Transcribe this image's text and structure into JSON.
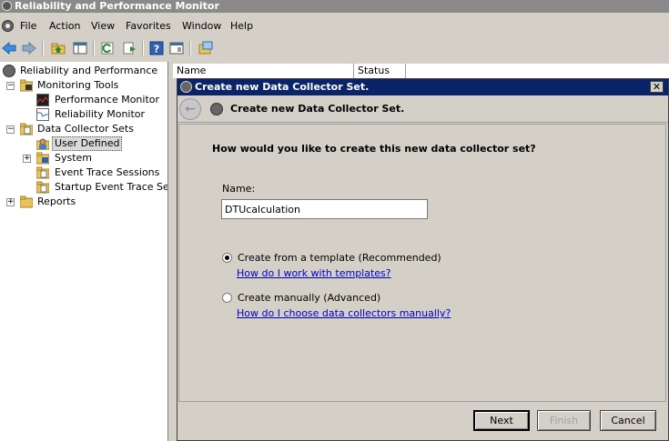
{
  "window": {
    "title": "Reliability and Performance Monitor"
  },
  "menu": [
    "File",
    "Action",
    "View",
    "Favorites",
    "Window",
    "Help"
  ],
  "toolbar": {
    "icons": [
      "back-arrow-icon",
      "forward-arrow-icon",
      "up-folder-icon",
      "show-hide-tree-icon",
      "refresh-icon",
      "export-list-icon",
      "help-icon",
      "properties-icon",
      "new-window-icon"
    ]
  },
  "tree": {
    "root": "Reliability and Performance",
    "monitoring_tools": "Monitoring Tools",
    "performance_monitor": "Performance Monitor",
    "reliability_monitor": "Reliability Monitor",
    "data_collector_sets": "Data Collector Sets",
    "user_defined": "User Defined",
    "system": "System",
    "event_trace_sessions": "Event Trace Sessions",
    "startup_event_trace": "Startup Event Trace Sess",
    "reports": "Reports"
  },
  "list": {
    "columns": [
      "Name",
      "Status"
    ]
  },
  "dialog": {
    "title": "Create new Data Collector Set.",
    "header": "Create new Data Collector Set.",
    "question": "How would you like to create this new data collector set?",
    "name_label": "Name:",
    "name_value": "DTUcalculation",
    "option_template": "Create from a template (Recommended)",
    "link_template": "How do I work with templates?",
    "option_manual": "Create manually (Advanced)",
    "link_manual": "How do I choose data collectors manually?",
    "selected_option": "template",
    "buttons": {
      "next": "Next",
      "finish": "Finish",
      "cancel": "Cancel"
    }
  }
}
